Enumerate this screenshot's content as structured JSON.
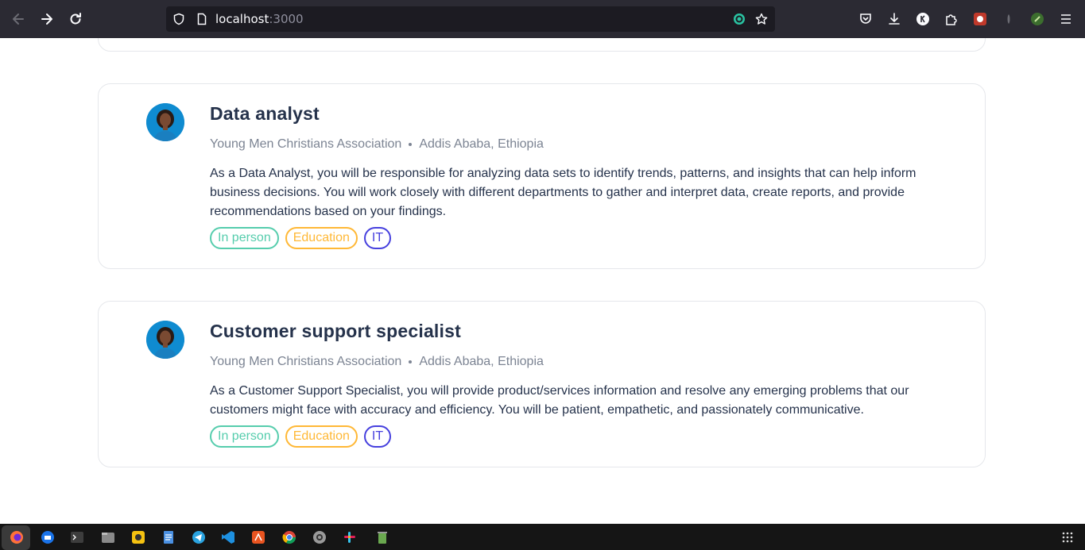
{
  "browser": {
    "url_host": "localhost",
    "url_port": ":3000"
  },
  "jobs": [
    {
      "title": "Data analyst",
      "company": "Young Men Christians Association",
      "location": "Addis Ababa, Ethiopia",
      "description": "As a Data Analyst, you will be responsible for analyzing data sets to identify trends, patterns, and insights that can help inform business decisions. You will work closely with different departments to gather and interpret data, create reports, and provide recommendations based on your findings.",
      "tags": [
        "In person",
        "Education",
        "IT"
      ]
    },
    {
      "title": "Customer support specialist",
      "company": "Young Men Christians Association",
      "location": "Addis Ababa, Ethiopia",
      "description": "As a Customer Support Specialist, you will provide product/services information and resolve any emerging problems that our customers might face with accuracy and efficiency. You will be patient, empathetic, and passionately communicative.",
      "tags": [
        "In person",
        "Education",
        "IT"
      ]
    }
  ],
  "colors": {
    "tag_in_person": "#56cdad",
    "tag_education": "#ffb836",
    "tag_it": "#4640de",
    "title": "#25324b",
    "meta": "#7c8493"
  },
  "taskbar_icons": [
    "firefox-icon",
    "thunderbird-icon",
    "terminal-icon",
    "files-icon",
    "rhythmbox-icon",
    "text-editor-icon",
    "telegram-icon",
    "vscode-icon",
    "app-center-icon",
    "chrome-icon",
    "settings-icon",
    "slack-icon",
    "trash-icon",
    "app-grid-icon"
  ]
}
